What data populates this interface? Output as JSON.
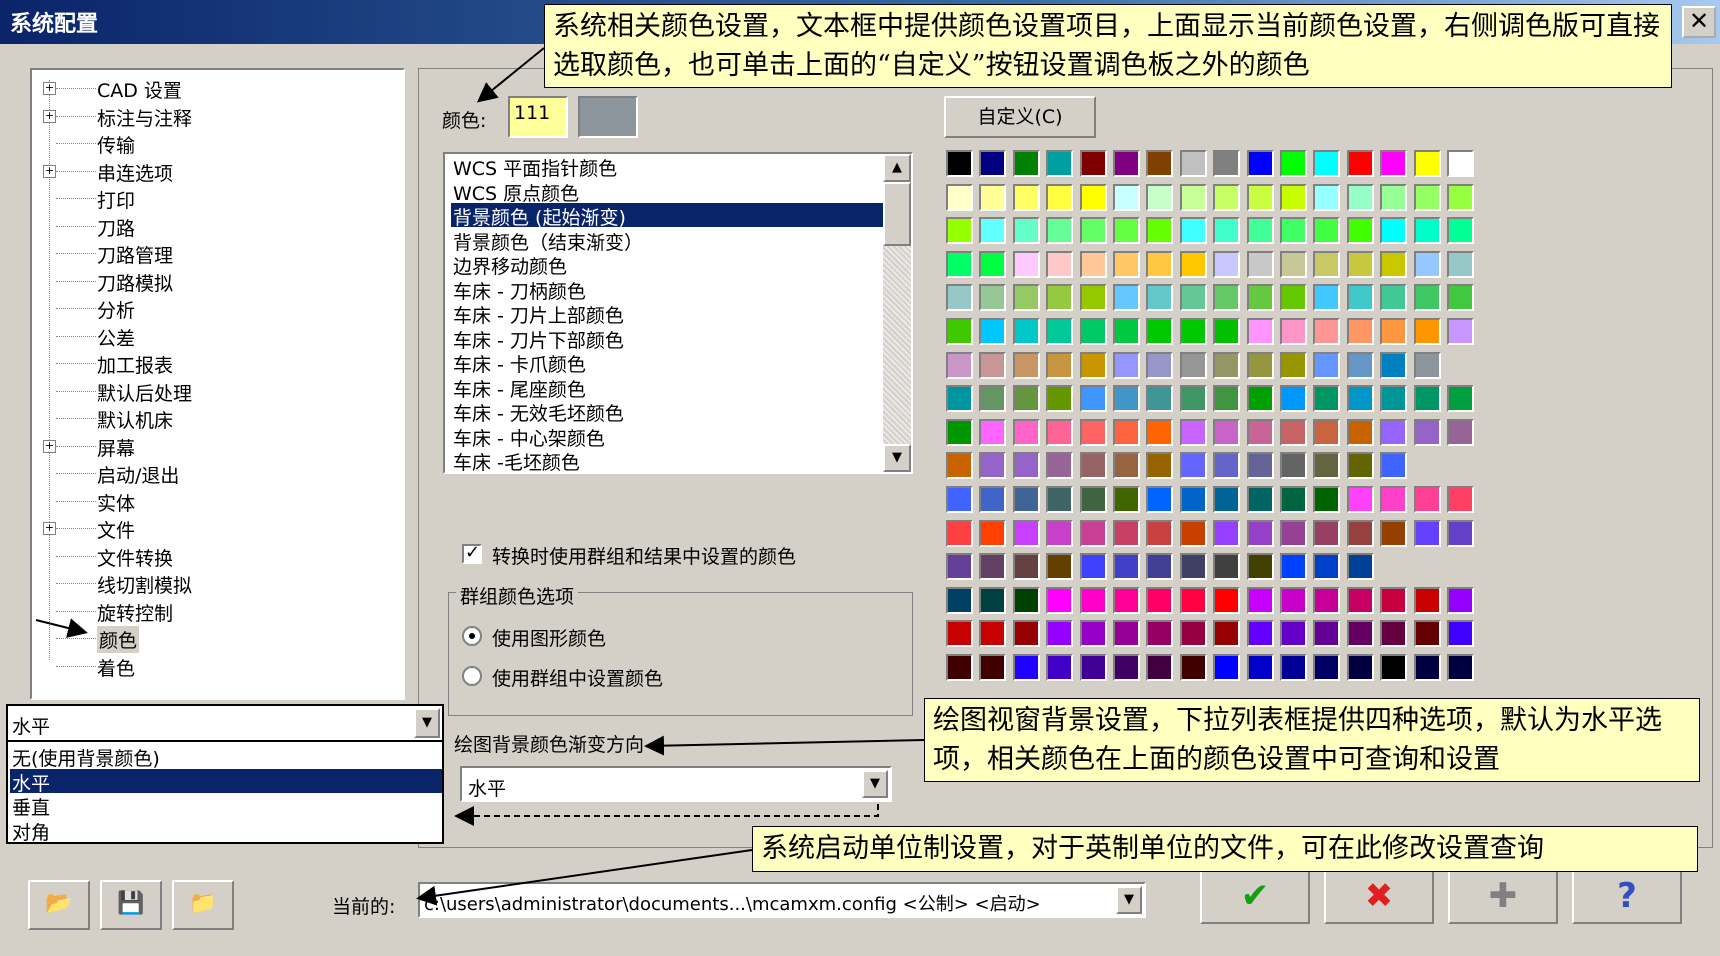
{
  "window": {
    "title": "系统配置",
    "close_label": "✕"
  },
  "tree": {
    "items": [
      {
        "label": "CAD 设置",
        "expandable": true
      },
      {
        "label": "标注与注释",
        "expandable": true
      },
      {
        "label": "传输",
        "expandable": false
      },
      {
        "label": "串连选项",
        "expandable": true
      },
      {
        "label": "打印",
        "expandable": false
      },
      {
        "label": "刀路",
        "expandable": false
      },
      {
        "label": "刀路管理",
        "expandable": false
      },
      {
        "label": "刀路模拟",
        "expandable": false
      },
      {
        "label": "分析",
        "expandable": false
      },
      {
        "label": "公差",
        "expandable": false
      },
      {
        "label": "加工报表",
        "expandable": false
      },
      {
        "label": "默认后处理",
        "expandable": false
      },
      {
        "label": "默认机床",
        "expandable": false
      },
      {
        "label": "屏幕",
        "expandable": true
      },
      {
        "label": "启动/退出",
        "expandable": false
      },
      {
        "label": "实体",
        "expandable": false
      },
      {
        "label": "文件",
        "expandable": true
      },
      {
        "label": "文件转换",
        "expandable": false
      },
      {
        "label": "线切割模拟",
        "expandable": false
      },
      {
        "label": "旋转控制",
        "expandable": false
      },
      {
        "label": "颜色",
        "expandable": false,
        "selected": true
      },
      {
        "label": "着色",
        "expandable": false
      }
    ]
  },
  "color": {
    "label": "颜色:",
    "value": "111",
    "preview_color": "#8c949c",
    "custom_button": "自定义(C)"
  },
  "color_items": [
    "WCS 平面指针颜色",
    "WCS 原点颜色",
    "背景颜色 (起始渐变)",
    "背景颜色（结束渐变）",
    "边界移动颜色",
    "车床 - 刀柄颜色",
    "车床 - 刀片上部颜色",
    "车床 - 刀片下部颜色",
    "车床 - 卡爪颜色",
    "车床 - 尾座颜色",
    "车床 - 无效毛坯颜色",
    "车床 - 中心架颜色",
    "车床 -毛坯颜色"
  ],
  "selected_color_item": 2,
  "palette": [
    [
      "#000000",
      "#000080",
      "#008000",
      "#00a0a0",
      "#800000",
      "#800080",
      "#804000",
      "#c0c0c0",
      "#808080",
      "#0000ff",
      "#00ff00",
      "#00ffff",
      "#ff0000",
      "#ff00ff",
      "#ffff00",
      "#ffffff"
    ],
    [
      "#ffffc8",
      "#ffff96",
      "#ffff64",
      "#ffff40",
      "#ffff00",
      "#c8ffff",
      "#c8ffc8",
      "#c8ff96",
      "#c8ff64",
      "#c8ff40",
      "#c8ff00",
      "#96ffff",
      "#96ffc8",
      "#96ff96",
      "#96ff64",
      "#96ff40"
    ],
    [
      "#96ff00",
      "#64ffff",
      "#64ffc8",
      "#64ff96",
      "#64ff64",
      "#64ff40",
      "#64ff00",
      "#40ffff",
      "#40ffc8",
      "#40ff96",
      "#40ff64",
      "#40ff40",
      "#40ff00",
      "#00ffff",
      "#00ffc8",
      "#00ff96"
    ],
    [
      "#00ff64",
      "#00ff40",
      "#ffc8ff",
      "#ffc8c8",
      "#ffc896",
      "#ffc864",
      "#ffc840",
      "#ffc800",
      "#c8c8ff",
      "#c8c8c8",
      "#c8c896",
      "#c8c864",
      "#c8c840",
      "#c8c800",
      "#96c8ff",
      "#96c8c8"
    ],
    [
      "#96c8c8",
      "#96c896",
      "#96c864",
      "#96c840",
      "#96c800",
      "#64c8ff",
      "#64c8c8",
      "#64c896",
      "#64c864",
      "#64c840",
      "#64c800",
      "#40c8ff",
      "#40c8c8",
      "#40c896",
      "#40c864",
      "#40c840"
    ],
    [
      "#40c800",
      "#00c8ff",
      "#00c8c8",
      "#00c896",
      "#00c864",
      "#00c840",
      "#00c800",
      "#00c800",
      "#00c000",
      "#ff96ff",
      "#ff96c8",
      "#ff9696",
      "#ff9664",
      "#ff9640",
      "#ff9600",
      "#c896ff"
    ],
    [
      "#c896c8",
      "#c89696",
      "#c89664",
      "#c89640",
      "#c89600",
      "#9696ff",
      "#9696c8",
      "#969696",
      "#969664",
      "#969640",
      "#969600",
      "#6496ff",
      "#6496c8",
      "#0080c0",
      "#8c949c"
    ],
    [
      "#0096a0",
      "#649664",
      "#649640",
      "#649600",
      "#4096ff",
      "#4096c8",
      "#409696",
      "#409664",
      "#409640",
      "#00a000",
      "#0096ff",
      "#009664",
      "#0096c8",
      "#009696",
      "#009664",
      "#00a040"
    ],
    [
      "#009600",
      "#ff64ff",
      "#ff64c8",
      "#ff6496",
      "#ff6464",
      "#ff6440",
      "#ff6400",
      "#c864ff",
      "#c864c8",
      "#c86496",
      "#c86464",
      "#c86440",
      "#c86400",
      "#9664ff",
      "#9664c8",
      "#966496"
    ],
    [
      "#c86400",
      "#9664c8",
      "#9664c8",
      "#966496",
      "#966464",
      "#966440",
      "#966400",
      "#6464ff",
      "#6464c8",
      "#646496",
      "#646464",
      "#646440",
      "#646400",
      "#4064ff"
    ],
    [
      "#4064ff",
      "#4064c8",
      "#406496",
      "#406464",
      "#406440",
      "#406400",
      "#0064ff",
      "#0064c8",
      "#006496",
      "#006464",
      "#006440",
      "#006400",
      "#ff40ff",
      "#ff40c8",
      "#ff4096",
      "#ff4064"
    ],
    [
      "#ff4040",
      "#ff4000",
      "#c840ff",
      "#c840c8",
      "#c84096",
      "#c84064",
      "#c84040",
      "#c84000",
      "#9640ff",
      "#9640c8",
      "#964096",
      "#964064",
      "#964040",
      "#964000",
      "#6440ff",
      "#6440c8"
    ],
    [
      "#644096",
      "#644064",
      "#644040",
      "#644000",
      "#4040ff",
      "#4040c8",
      "#404096",
      "#404064",
      "#404040",
      "#404000",
      "#0040ff",
      "#0040c8",
      "#004096"
    ],
    [
      "#004064",
      "#004040",
      "#004000",
      "#ff00ff",
      "#ff00c8",
      "#ff0096",
      "#ff0064",
      "#ff0040",
      "#ff0000",
      "#c800ff",
      "#c800c8",
      "#c80096",
      "#c80064",
      "#c80040",
      "#c80000",
      "#9600ff"
    ],
    [
      "#c80000",
      "#c80000",
      "#960000",
      "#9600ff",
      "#9600c8",
      "#960096",
      "#960064",
      "#960040",
      "#960000",
      "#6400ff",
      "#6400c8",
      "#640096",
      "#640064",
      "#640040",
      "#640000",
      "#4000ff"
    ],
    [
      "#400000",
      "#400000",
      "#2000ff",
      "#4000c8",
      "#400096",
      "#400064",
      "#400040",
      "#400000",
      "#0000ff",
      "#0000c8",
      "#000096",
      "#000064",
      "#000040",
      "#000000",
      "#000040",
      "#000040"
    ]
  ],
  "selected_swatch": {
    "row": 6,
    "col": 15
  },
  "checkbox": {
    "label": "转换时使用群组和结果中设置的颜色",
    "checked": true
  },
  "group_options": {
    "title": "群组颜色选项",
    "options": [
      {
        "label": "使用图形颜色",
        "selected": true
      },
      {
        "label": "使用群组中设置颜色",
        "selected": false
      }
    ]
  },
  "gradient": {
    "label": "绘图背景颜色渐变方向",
    "value": "水平",
    "options": [
      "无(使用背景颜色)",
      "水平",
      "垂直",
      "对角"
    ],
    "selected_option": 1,
    "popup_value": "水平"
  },
  "bottom": {
    "current_label": "当前的:",
    "config_path": "c:\\users\\administrator\\documents...\\mcamxm.config <公制> <启动>",
    "buttons": {
      "ok": "✔",
      "cancel": "✖",
      "add": "✚",
      "help": "?"
    },
    "file_icons": [
      "open-folder-icon",
      "save-icon",
      "merge-folder-icon"
    ]
  },
  "callouts": {
    "top": "系统相关颜色设置，文本框中提供颜色设置项目，上面显示当前颜色设置，右侧调色版可直接选取颜色，也可单击上面的“自定义”按钮设置调色板之外的颜色",
    "middle": "绘图视窗背景设置，下拉列表框提供四种选项，默认为水平选项，相关颜色在上面的颜色设置中可查询和设置",
    "bottom": "系统启动单位制设置，对于英制单位的文件，可在此修改设置查询"
  }
}
